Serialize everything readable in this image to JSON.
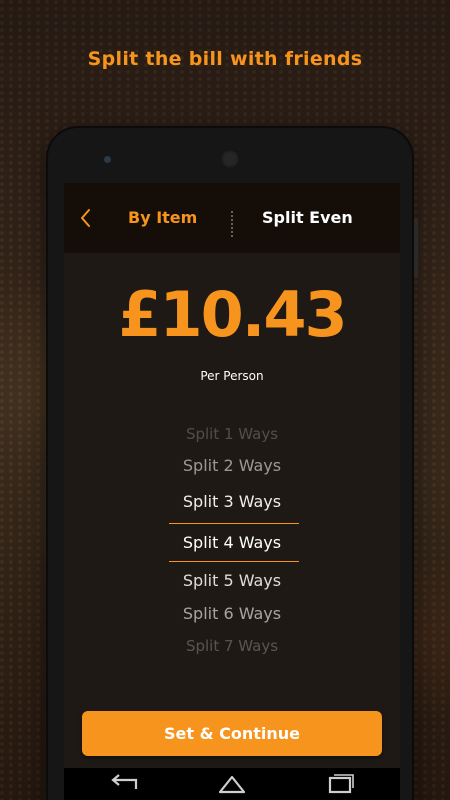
{
  "headline": "Split the bill with friends",
  "appbar": {
    "tab_by_item": "By Item",
    "tab_split_even": "Split Even"
  },
  "amount": {
    "value": "£10.43",
    "caption": "Per Person"
  },
  "picker": {
    "options": [
      "Split 1 Ways",
      "Split 2 Ways",
      "Split 3 Ways",
      "Split 4 Ways",
      "Split 5 Ways",
      "Split 6 Ways",
      "Split 7 Ways"
    ],
    "selected": "Split 4 Ways"
  },
  "cta": {
    "label": "Set & Continue"
  },
  "icons": {
    "back": "chevron-left-icon",
    "nav_back": "nav-back-icon",
    "nav_home": "nav-home-icon",
    "nav_recent": "nav-recent-icon"
  },
  "colors": {
    "accent": "#f7941d",
    "text": "#ffffff",
    "appbar_bg": "#160c06"
  }
}
